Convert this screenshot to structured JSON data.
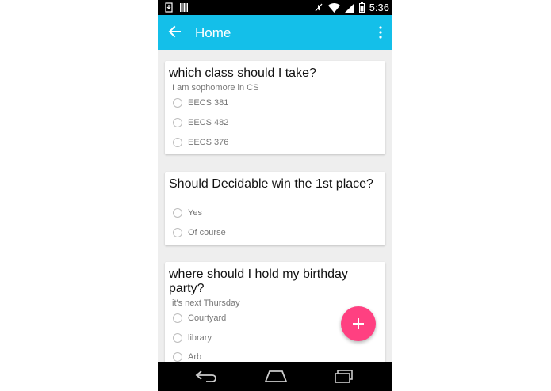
{
  "statusbar": {
    "time": "5:36"
  },
  "appbar": {
    "title": "Home"
  },
  "polls": [
    {
      "question": "which class should I take?",
      "subtitle": "I am sophomore in CS",
      "options": [
        "EECS 381",
        "EECS 482",
        "EECS 376"
      ]
    },
    {
      "question": "Should Decidable win the 1st place?",
      "subtitle": "",
      "options": [
        "Yes",
        "Of course"
      ]
    },
    {
      "question": "where should I hold my birthday party?",
      "subtitle": "it's next Thursday",
      "options": [
        "Courtyard",
        "library",
        "Arb"
      ]
    }
  ],
  "colors": {
    "appbar": "#14bfe9",
    "fab": "#ff4081"
  },
  "icons": {
    "back": "arrow-left-icon",
    "menu": "more-vert-icon",
    "fab": "plus-icon",
    "nav": [
      "back-icon",
      "home-icon",
      "recents-icon"
    ]
  }
}
